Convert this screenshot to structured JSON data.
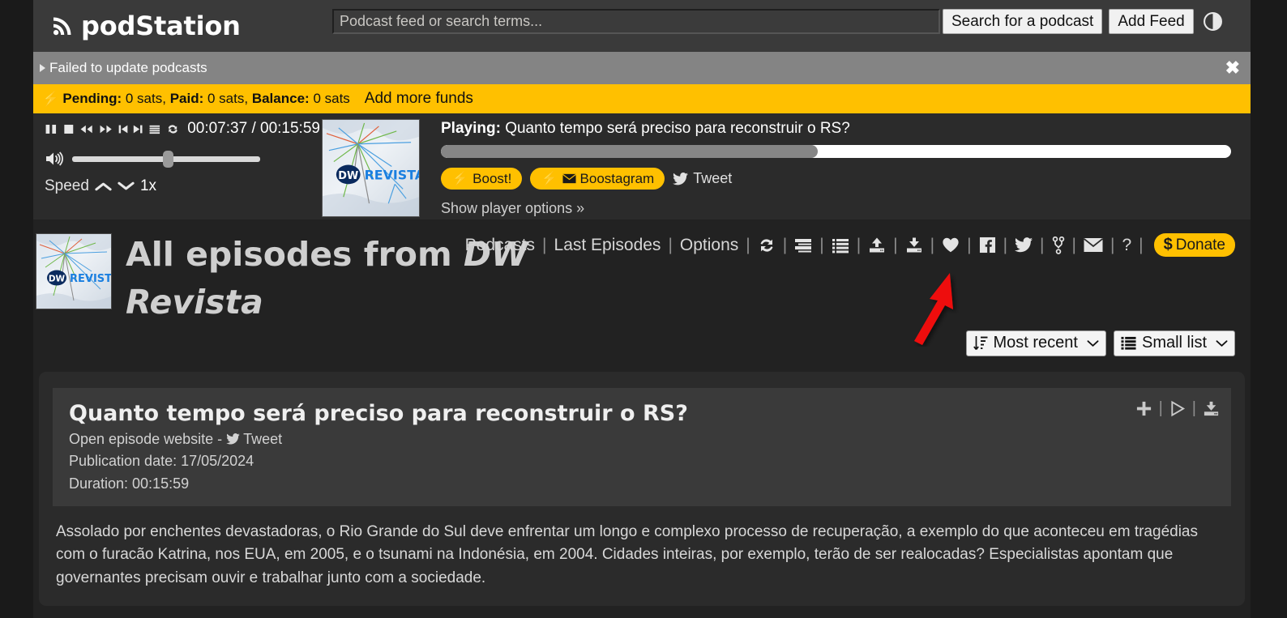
{
  "header": {
    "brand": "podStation",
    "brand_icon": "rss-icon",
    "search_placeholder": "Podcast feed or search terms...",
    "search_value": "",
    "search_button": "Search for a podcast",
    "add_feed_button": "Add Feed",
    "theme_toggle_icon": "contrast-half-circle-icon"
  },
  "alerts": {
    "update_error": "Failed to update podcasts",
    "close_icon": "close-icon",
    "expand_icon": "triangle-right-icon"
  },
  "funds": {
    "bolt_icon": "lightning-bolt-icon",
    "pending_label": "Pending:",
    "pending_value": "0 sats,",
    "paid_label": "Paid:",
    "paid_value": "0 sats,",
    "balance_label": "Balance:",
    "balance_value": "0 sats",
    "add_funds_link": "Add more funds",
    "bar_color": "#FFC000"
  },
  "player": {
    "controls": [
      {
        "name": "pause-icon"
      },
      {
        "name": "stop-icon"
      },
      {
        "name": "rewind-icon"
      },
      {
        "name": "fast-forward-icon"
      },
      {
        "name": "previous-track-icon"
      },
      {
        "name": "next-track-icon"
      },
      {
        "name": "playlist-icon"
      },
      {
        "name": "loop-icon"
      }
    ],
    "current_time": "00:07:37",
    "time_separator": " / ",
    "total_time": "00:15:59",
    "time_display": "00:07:37 / 00:15:59",
    "volume_icon": "speaker-volume-icon",
    "volume_percent": 51,
    "speed_label": "Speed",
    "speed_up_icon": "chevron-up-icon",
    "speed_down_icon": "chevron-down-icon",
    "speed_value": "1x",
    "artwork_alt": "DW REVISTA podcast artwork",
    "artwork_logo_dw": "DW",
    "artwork_logo_revista": "REVISTA",
    "playing_label": "Playing:",
    "playing_title": "Quanto tempo será preciso para reconstruir o RS?",
    "progress_percent": 47.7,
    "boost_button": "Boost!",
    "boost_icon": "lightning-bolt-icon",
    "boostagram_button": "Boostagram",
    "boostagram_icons": "lightning-bolt-envelope-icon",
    "tweet_link": "Tweet",
    "tweet_icon": "twitter-bird-icon",
    "show_options_link": "Show player options »"
  },
  "title_section": {
    "prefix": "All episodes from ",
    "podcast_name": "DW Revista",
    "thumb_alt": "DW REVISTA podcast thumbnail"
  },
  "nav": {
    "links": [
      {
        "label": "Podcasts",
        "name": "nav-podcasts"
      },
      {
        "label": "Last Episodes",
        "name": "nav-last-episodes"
      },
      {
        "label": "Options",
        "name": "nav-options"
      }
    ],
    "separator": "|",
    "icons": [
      {
        "name": "refresh-icon"
      },
      {
        "name": "large-list-view-icon"
      },
      {
        "name": "small-list-view-icon"
      },
      {
        "name": "upload-icon"
      },
      {
        "name": "download-icon"
      },
      {
        "name": "heart-icon"
      },
      {
        "name": "facebook-icon"
      },
      {
        "name": "twitter-icon"
      },
      {
        "name": "git-branch-icon"
      },
      {
        "name": "mail-icon"
      },
      {
        "name": "help-icon"
      }
    ],
    "help_label": "?",
    "donate_label": "Donate",
    "donate_symbol": "$",
    "donate_color": "#FFC000"
  },
  "annotation": {
    "arrow_color": "#ee1111",
    "points_at": "download-icon"
  },
  "controls": {
    "sort_icon": "sort-descending-icon",
    "sort_value": "Most recent",
    "sort_options": [
      "Most recent"
    ],
    "view_icon": "list-view-icon",
    "view_value": "Small list",
    "view_options": [
      "Small list"
    ],
    "caret_icon": "chevron-down-icon"
  },
  "episode": {
    "title": "Quanto tempo será preciso para reconstruir o RS?",
    "website_link": "Open episode website",
    "dash": " - ",
    "tweet_link": "Tweet",
    "tweet_icon": "twitter-bird-icon",
    "pubdate_label": "Publication date:",
    "pubdate_value": "17/05/2024",
    "pubdate_line": "Publication date: 17/05/2024",
    "duration_label": "Duration:",
    "duration_value": "00:15:59",
    "duration_line": "Duration: 00:15:59",
    "actions": [
      {
        "name": "add-to-playlist-icon",
        "glyph": "+"
      },
      {
        "name": "play-icon",
        "glyph": "▶"
      },
      {
        "name": "download-episode-icon",
        "glyph": "⤓"
      }
    ],
    "description": "Assolado por enchentes devastadoras, o Rio Grande do Sul deve enfrentar um longo e complexo processo de recuperação, a exemplo do que aconteceu em tragédias com o furacão Katrina, nos EUA, em 2005, e o tsunami na Indonésia, em 2004. Cidades inteiras, por exemplo, terão de ser realocadas? Especialistas apontam que governantes precisam ouvir e trabalhar junto com a sociedade."
  }
}
